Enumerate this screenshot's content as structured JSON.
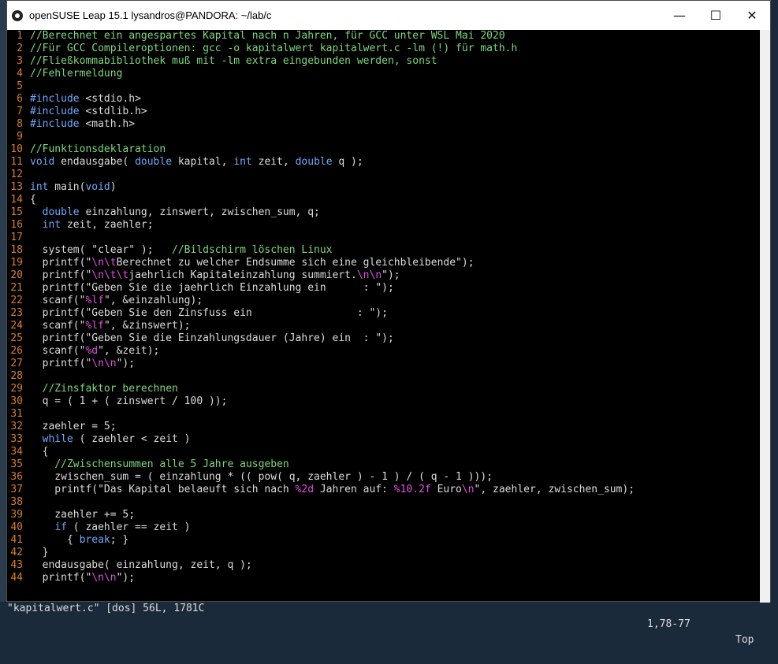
{
  "window": {
    "title": "openSUSE Leap 15.1  lysandros@PANDORA: ~/lab/c",
    "controls": {
      "minimize": "—",
      "maximize": "☐",
      "close": "✕"
    }
  },
  "colors": {
    "line_number": "#d97c2c",
    "comment": "#7fd77f",
    "keyword": "#6fa8ff",
    "format_spec": "#e04ee0",
    "text": "#dcdcdc",
    "background": "#000000"
  },
  "editor": {
    "lines": [
      {
        "n": "1",
        "segs": [
          [
            "c",
            "//Berechnet ein angespartes Kapital nach n Jahren, für GCC unter WSL Mai 2020"
          ]
        ]
      },
      {
        "n": "2",
        "segs": [
          [
            "c",
            "//Für GCC Compileroptionen: gcc -o kapitalwert kapitalwert.c -lm (!) für math.h"
          ]
        ]
      },
      {
        "n": "3",
        "segs": [
          [
            "c",
            "//Fließkommabibliothek muß mit -lm extra eingebunden werden, sonst"
          ]
        ]
      },
      {
        "n": "4",
        "segs": [
          [
            "c",
            "//Fehlermeldung"
          ]
        ]
      },
      {
        "n": "5",
        "segs": []
      },
      {
        "n": "6",
        "segs": [
          [
            "pp",
            "#include "
          ],
          [
            "t",
            "<stdio.h>"
          ]
        ]
      },
      {
        "n": "7",
        "segs": [
          [
            "pp",
            "#include "
          ],
          [
            "t",
            "<stdlib.h>"
          ]
        ]
      },
      {
        "n": "8",
        "segs": [
          [
            "pp",
            "#include "
          ],
          [
            "t",
            "<math.h>"
          ]
        ]
      },
      {
        "n": "9",
        "segs": []
      },
      {
        "n": "10",
        "segs": [
          [
            "c",
            "//Funktionsdeklaration"
          ]
        ]
      },
      {
        "n": "11",
        "segs": [
          [
            "kw",
            "void"
          ],
          [
            "t",
            " endausgabe( "
          ],
          [
            "kw",
            "double"
          ],
          [
            "t",
            " kapital, "
          ],
          [
            "kw",
            "int"
          ],
          [
            "t",
            " zeit, "
          ],
          [
            "kw",
            "double"
          ],
          [
            "t",
            " q );"
          ]
        ]
      },
      {
        "n": "12",
        "segs": []
      },
      {
        "n": "13",
        "segs": [
          [
            "kw",
            "int"
          ],
          [
            "t",
            " main("
          ],
          [
            "kw",
            "void"
          ],
          [
            "t",
            ")"
          ]
        ]
      },
      {
        "n": "14",
        "segs": [
          [
            "t",
            "{"
          ]
        ]
      },
      {
        "n": "15",
        "segs": [
          [
            "t",
            "  "
          ],
          [
            "kw",
            "double"
          ],
          [
            "t",
            " einzahlung, zinswert, zwischen_sum, q;"
          ]
        ]
      },
      {
        "n": "16",
        "segs": [
          [
            "t",
            "  "
          ],
          [
            "kw",
            "int"
          ],
          [
            "t",
            " zeit, zaehler;"
          ]
        ]
      },
      {
        "n": "17",
        "segs": []
      },
      {
        "n": "18",
        "segs": [
          [
            "t",
            "  system( \"clear\" );   "
          ],
          [
            "c",
            "//Bildschirm löschen Linux"
          ]
        ]
      },
      {
        "n": "19",
        "segs": [
          [
            "t",
            "  printf(\""
          ],
          [
            "fmt",
            "\\n\\t"
          ],
          [
            "t",
            "Berechnet zu welcher Endsumme sich eine gleichbleibende\");"
          ]
        ]
      },
      {
        "n": "20",
        "segs": [
          [
            "t",
            "  printf(\""
          ],
          [
            "fmt",
            "\\n\\t\\t"
          ],
          [
            "t",
            "jaehrlich Kapitaleinzahlung summiert."
          ],
          [
            "fmt",
            "\\n\\n"
          ],
          [
            "t",
            "\");"
          ]
        ]
      },
      {
        "n": "21",
        "segs": [
          [
            "t",
            "  printf(\"Geben Sie die jaehrlich Einzahlung ein      : \");"
          ]
        ]
      },
      {
        "n": "22",
        "segs": [
          [
            "t",
            "  scanf(\""
          ],
          [
            "fmt",
            "%lf"
          ],
          [
            "t",
            "\", &einzahlung);"
          ]
        ]
      },
      {
        "n": "23",
        "segs": [
          [
            "t",
            "  printf(\"Geben Sie den Zinsfuss ein                 : \");"
          ]
        ]
      },
      {
        "n": "24",
        "segs": [
          [
            "t",
            "  scanf(\""
          ],
          [
            "fmt",
            "%lf"
          ],
          [
            "t",
            "\", &zinswert);"
          ]
        ]
      },
      {
        "n": "25",
        "segs": [
          [
            "t",
            "  printf(\"Geben Sie die Einzahlungsdauer (Jahre) ein  : \");"
          ]
        ]
      },
      {
        "n": "26",
        "segs": [
          [
            "t",
            "  scanf(\""
          ],
          [
            "fmt",
            "%d"
          ],
          [
            "t",
            "\", &zeit);"
          ]
        ]
      },
      {
        "n": "27",
        "segs": [
          [
            "t",
            "  printf(\""
          ],
          [
            "fmt",
            "\\n\\n"
          ],
          [
            "t",
            "\");"
          ]
        ]
      },
      {
        "n": "28",
        "segs": []
      },
      {
        "n": "29",
        "segs": [
          [
            "t",
            "  "
          ],
          [
            "c",
            "//Zinsfaktor berechnen"
          ]
        ]
      },
      {
        "n": "30",
        "segs": [
          [
            "t",
            "  q = ( 1 + ( zinswert / 100 ));"
          ]
        ]
      },
      {
        "n": "31",
        "segs": []
      },
      {
        "n": "32",
        "segs": [
          [
            "t",
            "  zaehler = 5;"
          ]
        ]
      },
      {
        "n": "33",
        "segs": [
          [
            "t",
            "  "
          ],
          [
            "kw",
            "while"
          ],
          [
            "t",
            " ( zaehler < zeit )"
          ]
        ]
      },
      {
        "n": "34",
        "segs": [
          [
            "t",
            "  {"
          ]
        ]
      },
      {
        "n": "35",
        "segs": [
          [
            "t",
            "    "
          ],
          [
            "c",
            "//Zwischensummen alle 5 Jahre ausgeben"
          ]
        ]
      },
      {
        "n": "36",
        "segs": [
          [
            "t",
            "    zwischen_sum = ( einzahlung * (( pow( q, zaehler ) - 1 ) / ( q - 1 )));"
          ]
        ]
      },
      {
        "n": "37",
        "segs": [
          [
            "t",
            "    printf(\"Das Kapital belaeuft sich nach "
          ],
          [
            "fmt",
            "%2d"
          ],
          [
            "t",
            " Jahren auf: "
          ],
          [
            "fmt",
            "%10.2f"
          ],
          [
            "t",
            " Euro"
          ],
          [
            "fmt",
            "\\n"
          ],
          [
            "t",
            "\", zaehler, zwischen_sum);"
          ]
        ]
      },
      {
        "n": "38",
        "segs": []
      },
      {
        "n": "39",
        "segs": [
          [
            "t",
            "    zaehler += 5;"
          ]
        ]
      },
      {
        "n": "40",
        "segs": [
          [
            "t",
            "    "
          ],
          [
            "kw",
            "if"
          ],
          [
            "t",
            " ( zaehler == zeit )"
          ]
        ]
      },
      {
        "n": "41",
        "segs": [
          [
            "t",
            "      { "
          ],
          [
            "kw",
            "break"
          ],
          [
            "t",
            "; }"
          ]
        ]
      },
      {
        "n": "42",
        "segs": [
          [
            "t",
            "  }"
          ]
        ]
      },
      {
        "n": "43",
        "segs": [
          [
            "t",
            "  endausgabe( einzahlung, zeit, q );"
          ]
        ]
      },
      {
        "n": "44",
        "segs": [
          [
            "t",
            "  printf(\""
          ],
          [
            "fmt",
            "\\n\\n"
          ],
          [
            "t",
            "\");"
          ]
        ]
      }
    ]
  },
  "statusbar": {
    "file_info": "\"kapitalwert.c\" [dos] 56L, 1781C",
    "cursor": "1,78-77",
    "scroll": "Top"
  }
}
